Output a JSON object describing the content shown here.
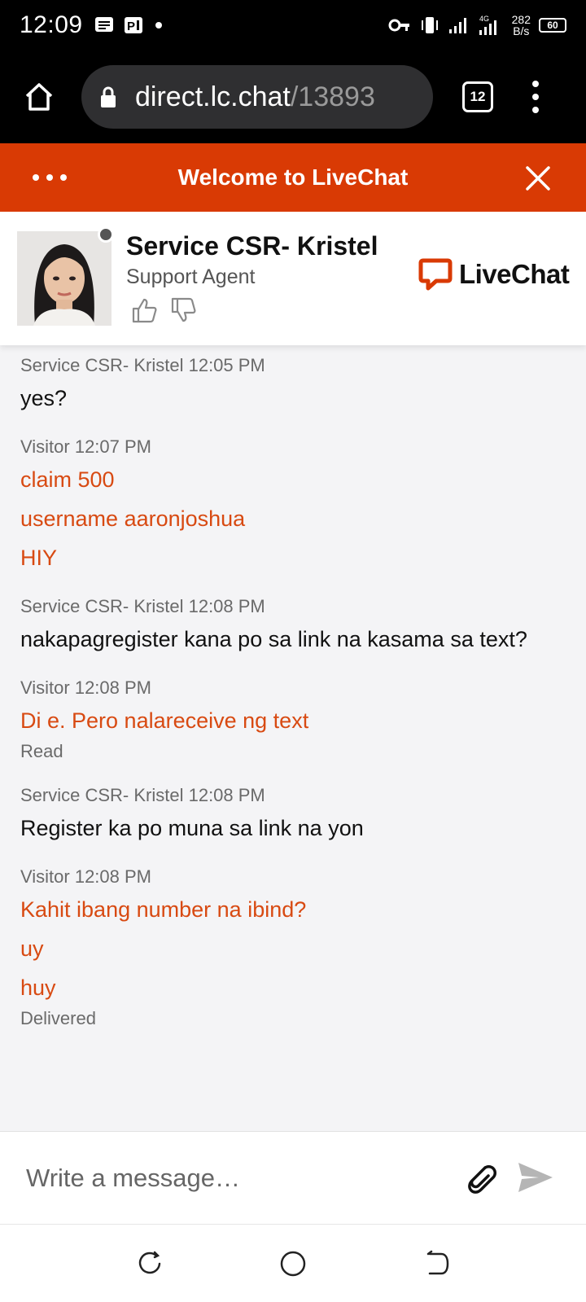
{
  "status_bar": {
    "time": "12:09",
    "net_speed_value": "282",
    "net_speed_unit": "B/s",
    "network_type": "4G",
    "battery": "60"
  },
  "browser": {
    "url_host": "direct.lc.chat",
    "url_path": "/13893",
    "tab_count": "12"
  },
  "livechat_header": {
    "title": "Welcome to LiveChat"
  },
  "agent": {
    "name": "Service CSR- Kristel",
    "role": "Support Agent",
    "status_color": "#555555"
  },
  "brand": {
    "logo_text": "LiveChat",
    "accent_color": "#d93a04",
    "visitor_text_color": "#d84a12"
  },
  "messages": [
    {
      "sender": "Service CSR- Kristel",
      "time": "12:05 PM",
      "meta": "Service CSR- Kristel 12:05 PM",
      "lines": [
        "yes?"
      ]
    },
    {
      "sender": "Visitor",
      "time": "12:07 PM",
      "meta": "Visitor 12:07 PM",
      "lines": [
        "claim 500",
        "username aaronjoshua",
        "HIY"
      ]
    },
    {
      "sender": "Service CSR- Kristel",
      "time": "12:08 PM",
      "meta": "Service CSR- Kristel 12:08 PM",
      "lines": [
        "nakapagregister kana po sa link na kasama sa text?"
      ]
    },
    {
      "sender": "Visitor",
      "time": "12:08 PM",
      "meta": "Visitor 12:08 PM",
      "lines": [
        "Di e. Pero nalareceive ng text"
      ],
      "receipt": "Read"
    },
    {
      "sender": "Service CSR- Kristel",
      "time": "12:08 PM",
      "meta": "Service CSR- Kristel 12:08 PM",
      "lines": [
        "Register ka po muna sa link na yon"
      ]
    },
    {
      "sender": "Visitor",
      "time": "12:08 PM",
      "meta": "Visitor 12:08 PM",
      "lines": [
        "Kahit ibang number na ibind?",
        "uy",
        "huy"
      ],
      "receipt": "Delivered"
    }
  ],
  "composer": {
    "placeholder": "Write a message…"
  }
}
